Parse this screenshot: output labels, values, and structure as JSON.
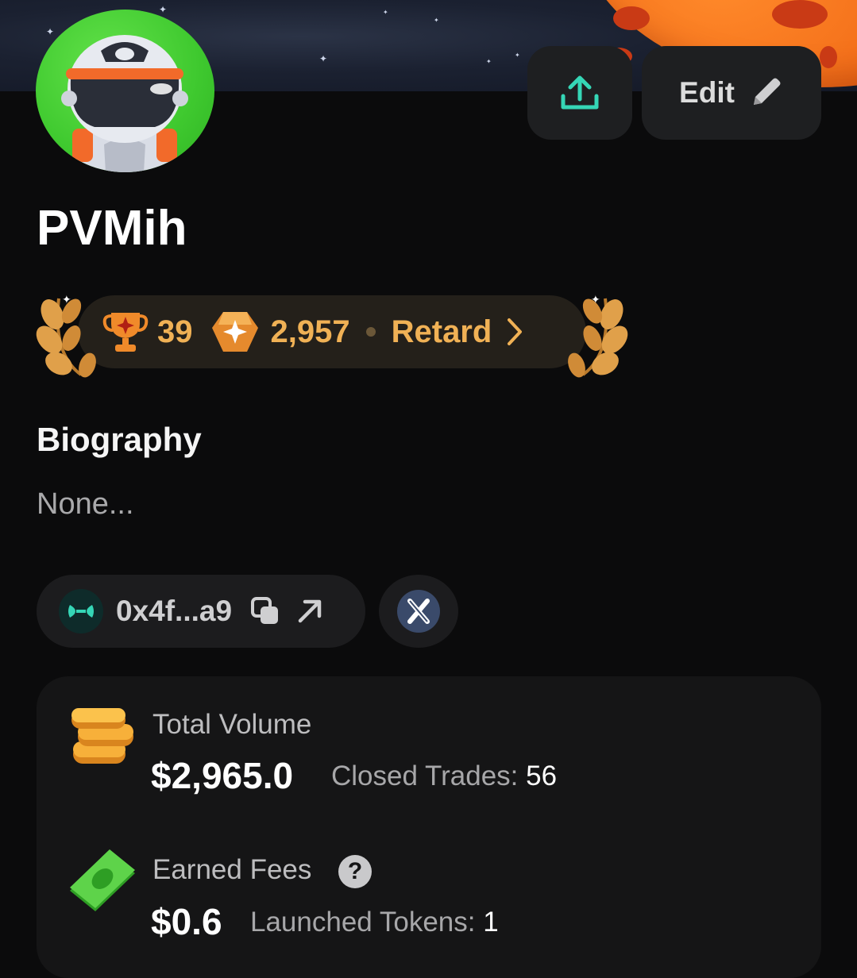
{
  "profile": {
    "username": "PVMih",
    "edit_label": "Edit",
    "share_icon": "share-upload-icon",
    "edit_icon": "pencil-icon"
  },
  "rank": {
    "trophy_count": "39",
    "points": "2,957",
    "tier": "Retard",
    "accent_color": "#f0b155"
  },
  "biography": {
    "title": "Biography",
    "text": "None..."
  },
  "wallet": {
    "address": "0x4f...a9",
    "copy_icon": "copy-icon",
    "open_icon": "external-link-icon",
    "social_icon": "x-icon"
  },
  "stats": {
    "total_volume_label": "Total Volume",
    "total_volume_value": "$2,965.0",
    "closed_trades_label": "Closed Trades:",
    "closed_trades_value": "56",
    "earned_fees_label": "Earned Fees",
    "earned_fees_value": "$0.6",
    "launched_tokens_label": "Launched Tokens:",
    "launched_tokens_value": "1"
  }
}
